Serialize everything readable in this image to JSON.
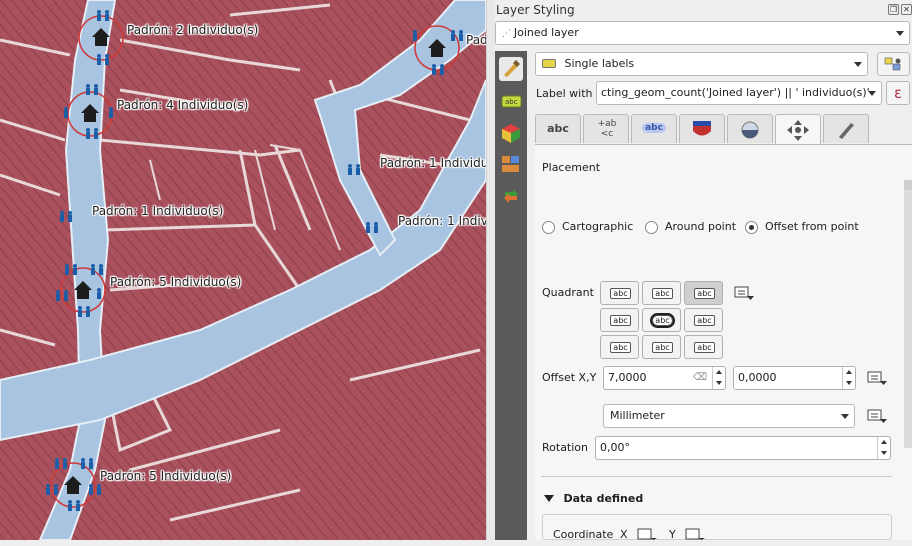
{
  "map": {
    "labels": [
      "Padrón: 2 Individuo(s)",
      "Padró",
      "Padrón: 4 Individuo(s)",
      "Padrón: 1 Individu",
      "Padrón: 1 Individuo(s)",
      "Padrón: 1 Individ",
      "Padrón: 5 Individuo(s)",
      "Padrón: 5 Individuo(s)"
    ],
    "colors": {
      "parcel": "#a9525e",
      "road": "#a8c4e0",
      "border": "#e8d8d8",
      "circle": "#d03a3a",
      "icon": "#1c5fa8"
    }
  },
  "panel": {
    "title": "Layer Styling",
    "layer_combo": "Joined layer",
    "renderer_combo": "Single labels",
    "label_with_caption": "Label with",
    "expression": "cting_geom_count('Joined layer') || ' individuo(s)'",
    "expression_button": "ε",
    "tabs": [
      "abc",
      "+ab <c",
      "abc",
      "",
      "",
      "",
      ""
    ],
    "placement_title": "Placement",
    "modes": [
      "Cartographic",
      "Around point",
      "Offset from point"
    ],
    "selected_mode": "Offset from point",
    "quadrant_label": "Quadrant",
    "quadrant_cell": "abc",
    "offset_label": "Offset X,Y",
    "offset_x": "7,0000",
    "offset_y": "0,0000",
    "unit": "Millimeter",
    "rotation_label": "Rotation",
    "rotation_value": "0,00°",
    "data_defined_title": "Data defined",
    "coordinate_label": "Coordinate",
    "coord_x": "X",
    "coord_y": "Y"
  }
}
